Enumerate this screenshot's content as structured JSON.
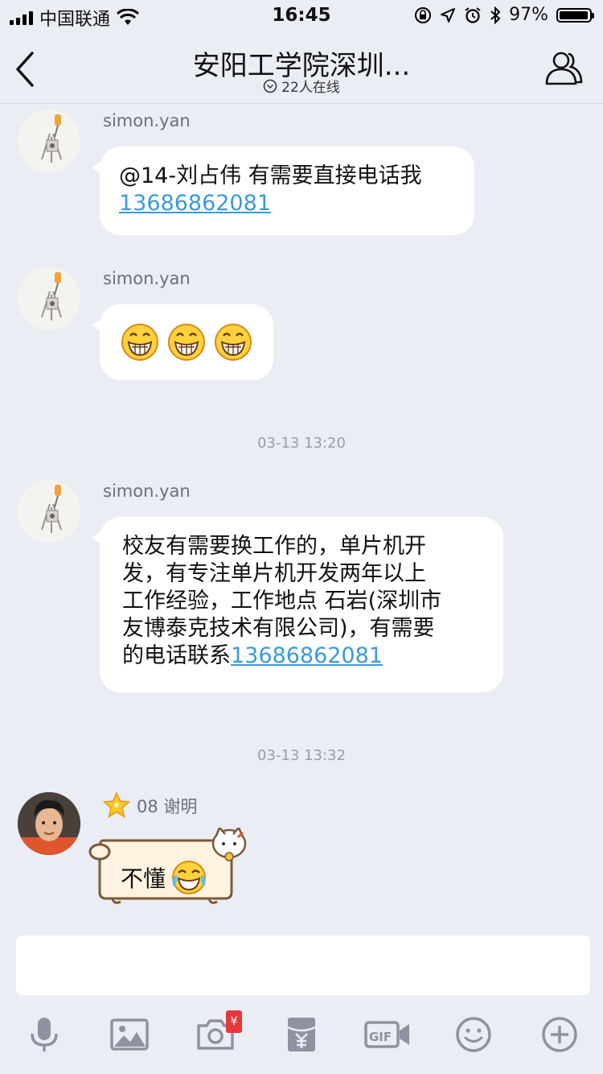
{
  "status_bar": {
    "carrier": "中国联通",
    "time": "16:45",
    "battery": "97%",
    "battery_level": 0.97
  },
  "header": {
    "back_icon": "chevron-left-icon",
    "title": "安阳工学院深圳...",
    "online": "22人在线",
    "members_icon": "group-members-icon"
  },
  "messages": [
    {
      "sender": "simon.yan",
      "text": "@14-刘占伟 有需要直接电话我",
      "phone": "13686862081"
    },
    {
      "sender": "simon.yan",
      "emojis": [
        "grin-emoji",
        "grin-emoji",
        "grin-emoji"
      ]
    },
    {
      "time": "03-13 13:20"
    },
    {
      "sender": "simon.yan",
      "lines": [
        "校友有需要换工作的，单片机开",
        "发，有专注单片机开发两年以上",
        "工作经验，工作地点 石岩(深圳市",
        "友博泰克技术有限公司)，有需要"
      ],
      "last_line_text": "的电话联系",
      "phone": "13686862081"
    },
    {
      "time": "03-13 13:32"
    },
    {
      "sender": "08 谢明",
      "text": "不懂",
      "emoji": "laugh-cry-emoji"
    }
  ],
  "input": {
    "placeholder": ""
  },
  "toolbar": {
    "items": [
      "microphone-icon",
      "image-icon",
      "camera-icon",
      "red-packet-icon",
      "gif-icon",
      "emoji-icon",
      "plus-icon"
    ],
    "camera_badge": "¥"
  },
  "colors": {
    "background": "#ebedf4",
    "link": "#3a9ad9",
    "meta_text": "#9a9da6",
    "badge_red": "#e5383b"
  }
}
